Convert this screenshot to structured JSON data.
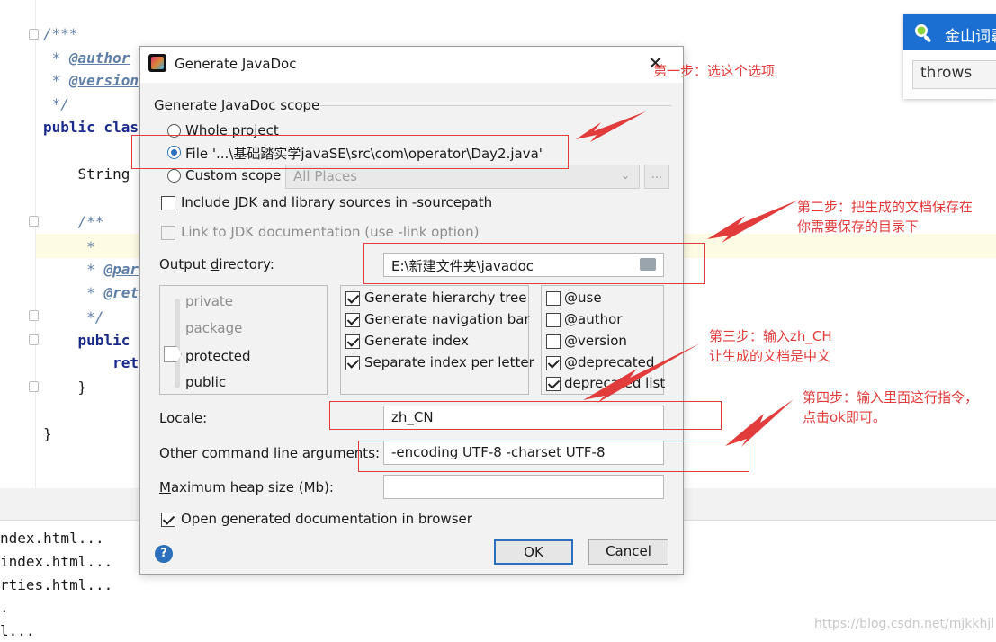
{
  "editor": {
    "code_lines": [
      {
        "text": "/***",
        "cls": "c-doc"
      },
      {
        "text": " * ",
        "tag": "@author",
        "cls": "c-doc"
      },
      {
        "text": " * ",
        "tag": "@version",
        "cls": "c-doc"
      },
      {
        "text": " */",
        "cls": "c-doc"
      },
      {
        "kw": "public clas",
        "cls": "c-kw"
      },
      {
        "text": "    String",
        "cls": "c-plain"
      },
      {
        "text": "    /**",
        "cls": "c-doc"
      },
      {
        "text": "     *",
        "cls": "c-doc"
      },
      {
        "text": "     * ",
        "tag": "@par",
        "cls": "c-doc"
      },
      {
        "text": "     * ",
        "tag": "@ret",
        "cls": "c-doc"
      },
      {
        "text": "     */",
        "cls": "c-doc"
      },
      {
        "kw": "    public",
        "cls": "c-kw"
      },
      {
        "kw": "        ret",
        "cls": "c-kw"
      },
      {
        "text": "    }",
        "cls": "c-plain"
      },
      {
        "text": "}",
        "cls": "c-plain"
      }
    ],
    "output_lines": [
      "ndex.html...",
      "index.html...",
      "rties.html...",
      ".",
      "l..."
    ]
  },
  "dictionary": {
    "title": "金山词霸",
    "query": "throws"
  },
  "dialog": {
    "title": "Generate JavaDoc",
    "scope_header": "Generate JavaDoc scope",
    "scope_options": [
      {
        "label": "Whole project",
        "checked": false
      },
      {
        "label": "File '...\\基础踏实学javaSE\\src\\com\\operator\\Day2.java'",
        "checked": true
      },
      {
        "label": "Custom scope",
        "checked": false
      }
    ],
    "custom_scope_value": "All Places",
    "custom_scope_button": "...",
    "include_jdk": {
      "label": "Include JDK and library sources in -sourcepath",
      "checked": false
    },
    "link_jdk": {
      "label": "Link to JDK documentation (use -link option)",
      "checked": false,
      "enabled": false
    },
    "output_dir_label": "Output directory:",
    "output_dir_value": "E:\\新建文件夹\\javadoc",
    "visibility_levels": [
      "private",
      "package",
      "protected",
      "public"
    ],
    "visibility_selected": "protected",
    "generate_options": [
      {
        "label": "Generate hierarchy tree",
        "checked": true
      },
      {
        "label": "Generate navigation bar",
        "checked": true
      },
      {
        "label": "Generate index",
        "checked": true
      },
      {
        "label": "Separate index per letter",
        "checked": true
      }
    ],
    "tag_options": [
      {
        "label": "@use",
        "checked": false
      },
      {
        "label": "@author",
        "checked": false
      },
      {
        "label": "@version",
        "checked": false
      },
      {
        "label": "@deprecated",
        "checked": true
      },
      {
        "label": "deprecated list",
        "checked": true
      }
    ],
    "locale_label": "Locale:",
    "locale_value": "zh_CN",
    "args_label": "Other command line arguments:",
    "args_value": "-encoding UTF-8 -charset UTF-8",
    "heap_label": "Maximum heap size (Mb):",
    "heap_value": "",
    "open_browser": {
      "label": "Open generated documentation in browser",
      "checked": true
    },
    "help_glyph": "?",
    "ok_label": "OK",
    "cancel_label": "Cancel"
  },
  "annotations": {
    "step1": "第一步：选这个选项",
    "step2_line1": "第二步：把生成的文档保存在",
    "step2_line2": "你需要保存的目录下",
    "step3_line1": "第三步：输入zh_CH",
    "step3_line2": "让生成的文档是中文",
    "step4_line1": "第四步：输入里面这行指令，",
    "step4_line2": "点击ok即可。",
    "color": "#e23b3b"
  },
  "watermark": "https://blog.csdn.net/mjkkhjl"
}
